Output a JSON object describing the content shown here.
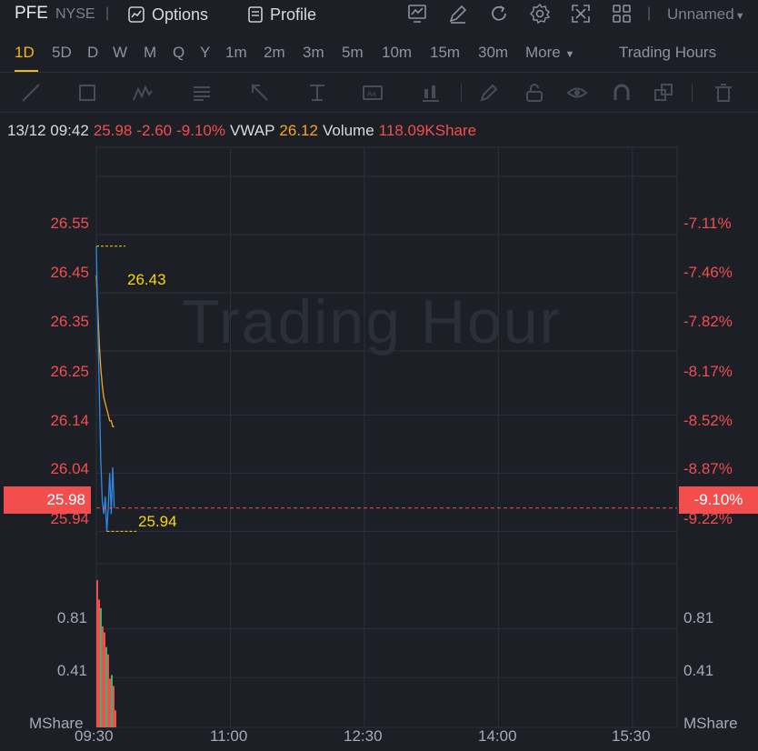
{
  "header": {
    "symbol": "PFE",
    "exchange": "NYSE",
    "options_label": "Options",
    "profile_label": "Profile",
    "layout_name": "Unnamed",
    "icons": [
      "chart-style-icon",
      "draw-pen-icon",
      "refresh-icon",
      "settings-icon",
      "fullscreen-icon",
      "grid-layout-icon"
    ]
  },
  "periods": {
    "items": [
      "1D",
      "5D",
      "D",
      "W",
      "M",
      "Q",
      "Y",
      "1m",
      "2m",
      "3m",
      "5m",
      "10m",
      "15m",
      "30m"
    ],
    "active": "1D",
    "more_label": "More",
    "session_label": "Trading Hours"
  },
  "drawing_tools": [
    "line-tool-icon",
    "rectangle-tool-icon",
    "pattern-tool-icon",
    "fibonacci-tool-icon",
    "arrow-tool-icon",
    "price-line-tool-icon",
    "text-tool-icon",
    "indicator-tool-icon",
    "brush-icon",
    "lock-icon",
    "eye-icon",
    "magnet-icon",
    "layers-icon",
    "trash-icon"
  ],
  "info": {
    "datetime": "13/12 09:42",
    "price": "25.98",
    "change": "-2.60",
    "change_pct": "-9.10%",
    "vwap_label": "VWAP",
    "vwap_value": "26.12",
    "volume_label": "Volume",
    "volume_value": "118.09KShare"
  },
  "chart": {
    "watermark": "Trading Hour",
    "price_labels": [
      "26.55",
      "26.45",
      "26.35",
      "26.25",
      "26.14",
      "26.04",
      "25.94"
    ],
    "pct_labels": [
      "-7.11%",
      "-7.46%",
      "-7.82%",
      "-8.17%",
      "-8.52%",
      "-8.87%",
      "-9.22%"
    ],
    "current_price_tag": "25.98",
    "current_pct_tag": "-9.10%",
    "high_annotation": "26.43",
    "low_annotation": "25.94",
    "volume_labels_left": [
      "0.81",
      "0.41"
    ],
    "volume_labels_right": [
      "0.81",
      "0.41"
    ],
    "volume_unit_left": "MShare",
    "volume_unit_right": "MShare",
    "time_labels": [
      "09:30",
      "11:00",
      "12:30",
      "14:00",
      "15:30"
    ],
    "colors": {
      "up": "#f24e4e",
      "down": "#3cb371",
      "price_line": "#2e8ae6",
      "vwap_line": "#f5a623",
      "annotation": "#ffd400",
      "background": "#1c1f26"
    }
  },
  "chart_data": {
    "type": "line",
    "xlabel": "",
    "ylabel": "",
    "x": [
      "09:30",
      "09:31",
      "09:32",
      "09:33",
      "09:34",
      "09:35",
      "09:36",
      "09:37",
      "09:38",
      "09:39",
      "09:40",
      "09:41",
      "09:42"
    ],
    "series": [
      {
        "values": [
          26.43,
          26.3,
          26.18,
          26.06,
          25.99,
          25.97,
          26.0,
          25.94,
          25.98,
          26.04,
          25.97,
          26.05,
          25.98
        ]
      },
      {
        "name": "VWAP",
        "values": [
          26.38,
          26.32,
          26.26,
          26.22,
          26.19,
          26.17,
          26.16,
          26.15,
          26.14,
          26.13,
          26.13,
          26.12,
          26.12
        ]
      }
    ],
    "x_range": [
      "09:30",
      "16:00"
    ],
    "ylim": [
      25.9,
      26.6
    ],
    "y_ticks": [
      26.55,
      26.45,
      26.35,
      26.25,
      26.14,
      26.04,
      25.94
    ],
    "volume_unit": "MShare",
    "volume_ticks": [
      0.81,
      0.41
    ],
    "volume_bars_mshare": [
      1.21,
      1.05,
      0.98,
      0.83,
      0.78,
      0.66,
      0.6,
      0.4,
      0.43,
      0.34,
      0.14
    ],
    "high": 26.43,
    "low": 25.94,
    "grid": true
  }
}
